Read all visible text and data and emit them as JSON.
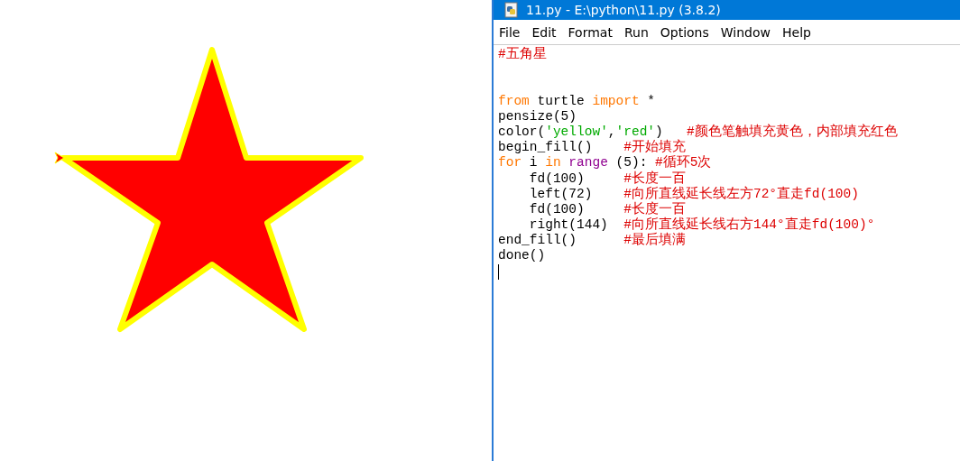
{
  "window": {
    "title": "11.py - E:\\python\\11.py (3.8.2)"
  },
  "menu": [
    {
      "label": "File"
    },
    {
      "label": "Edit"
    },
    {
      "label": "Format"
    },
    {
      "label": "Run"
    },
    {
      "label": "Options"
    },
    {
      "label": "Window"
    },
    {
      "label": "Help"
    }
  ],
  "code_lines": [
    {
      "kind": "code",
      "tokens": [
        {
          "kind": "comment",
          "text": "#五角星"
        }
      ]
    },
    {
      "kind": "blank"
    },
    {
      "kind": "blank"
    },
    {
      "kind": "code",
      "tokens": [
        {
          "kind": "keyword",
          "text": "from"
        },
        {
          "kind": "plain",
          "text": " turtle "
        },
        {
          "kind": "keyword",
          "text": "import"
        },
        {
          "kind": "plain",
          "text": " *"
        }
      ]
    },
    {
      "kind": "code",
      "tokens": [
        {
          "kind": "plain",
          "text": "pensize(5)"
        }
      ]
    },
    {
      "kind": "code",
      "tokens": [
        {
          "kind": "plain",
          "text": "color("
        },
        {
          "kind": "string",
          "text": "'yellow'"
        },
        {
          "kind": "plain",
          "text": ","
        },
        {
          "kind": "string",
          "text": "'red'"
        },
        {
          "kind": "plain",
          "text": ")   "
        },
        {
          "kind": "comment",
          "text": "#颜色笔触填充黄色，内部填充红色"
        }
      ]
    },
    {
      "kind": "code",
      "tokens": [
        {
          "kind": "plain",
          "text": "begin_fill()    "
        },
        {
          "kind": "comment",
          "text": "#开始填充"
        }
      ]
    },
    {
      "kind": "code",
      "tokens": [
        {
          "kind": "keyword",
          "text": "for"
        },
        {
          "kind": "plain",
          "text": " i "
        },
        {
          "kind": "keyword",
          "text": "in"
        },
        {
          "kind": "builtin",
          "text": " range"
        },
        {
          "kind": "plain",
          "text": " (5): "
        },
        {
          "kind": "comment",
          "text": "#循环5次"
        }
      ]
    },
    {
      "kind": "code",
      "tokens": [
        {
          "kind": "plain",
          "text": "    fd(100)     "
        },
        {
          "kind": "comment",
          "text": "#长度一百"
        }
      ]
    },
    {
      "kind": "code",
      "tokens": [
        {
          "kind": "plain",
          "text": "    left(72)    "
        },
        {
          "kind": "comment",
          "text": "#向所直线延长线左方72°直走fd(100)"
        }
      ]
    },
    {
      "kind": "code",
      "tokens": [
        {
          "kind": "plain",
          "text": "    fd(100)     "
        },
        {
          "kind": "comment",
          "text": "#长度一百"
        }
      ]
    },
    {
      "kind": "code",
      "tokens": [
        {
          "kind": "plain",
          "text": "    right(144)  "
        },
        {
          "kind": "comment",
          "text": "#向所直线延长线右方144°直走fd(100)°"
        }
      ]
    },
    {
      "kind": "code",
      "tokens": [
        {
          "kind": "plain",
          "text": "end_fill()      "
        },
        {
          "kind": "comment",
          "text": "#最后填满"
        }
      ]
    },
    {
      "kind": "code",
      "tokens": [
        {
          "kind": "plain",
          "text": "done()"
        }
      ]
    }
  ]
}
